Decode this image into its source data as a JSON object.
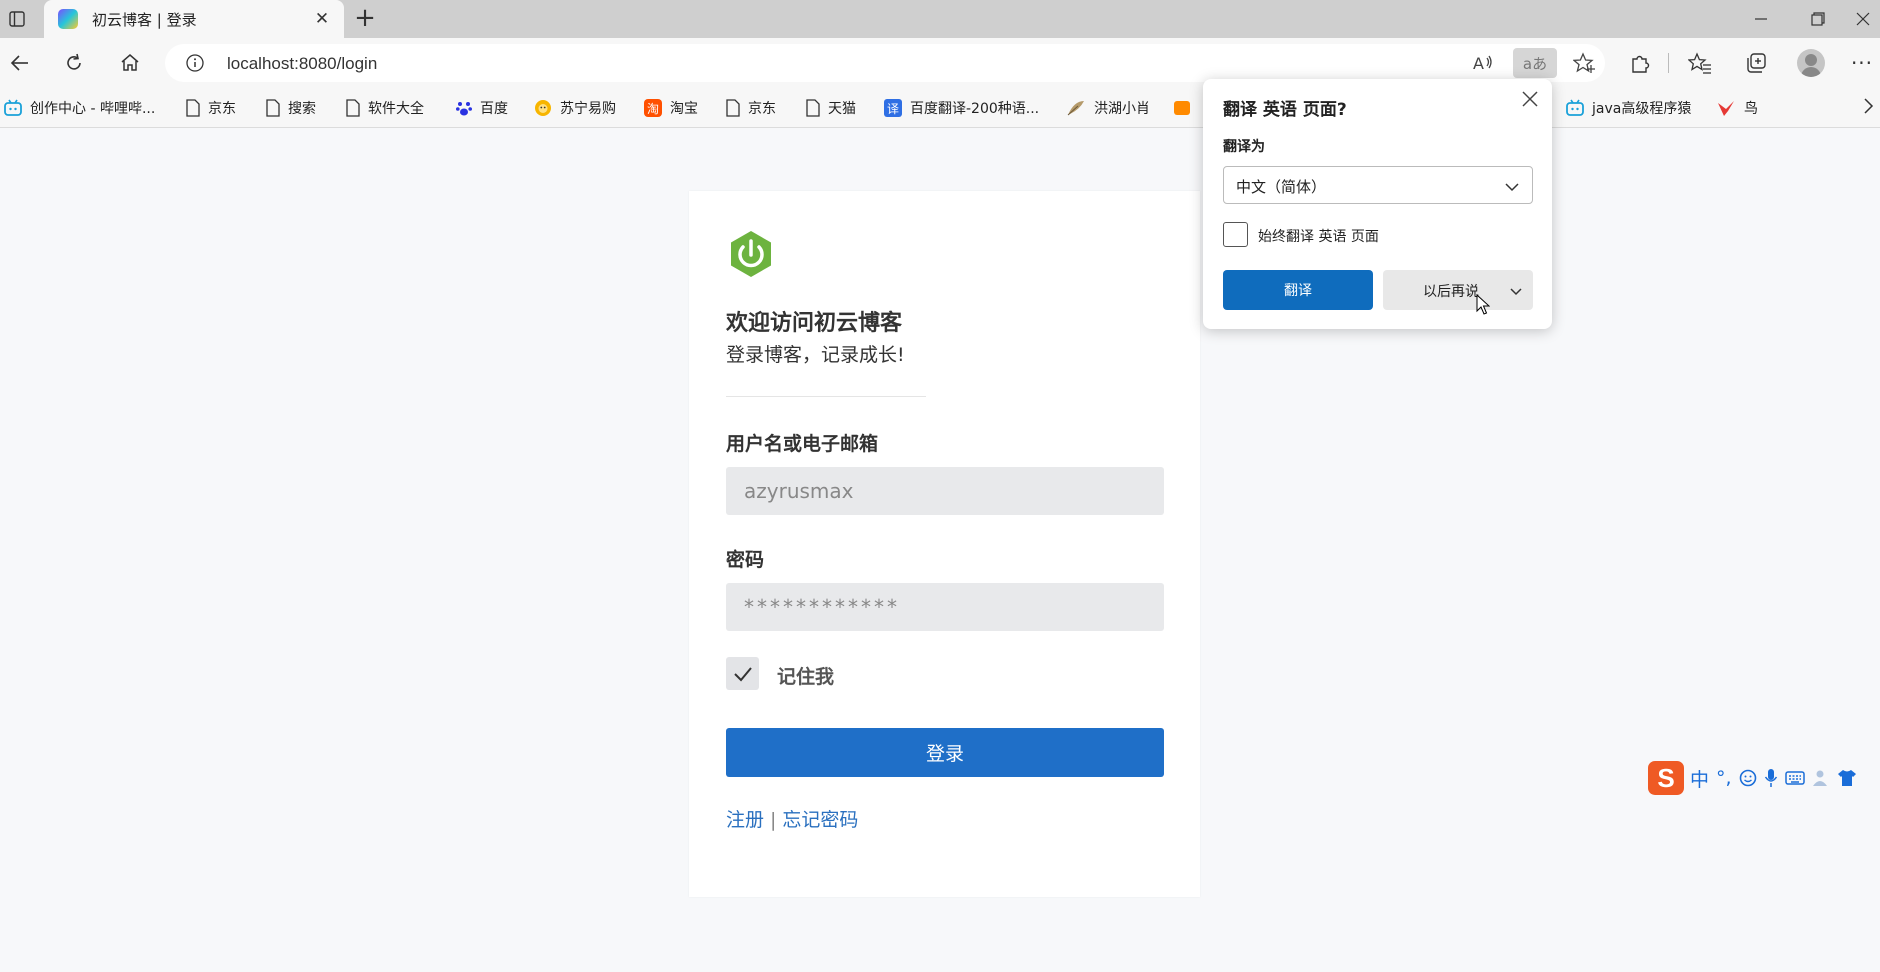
{
  "browser": {
    "tab": {
      "title": "初云博客 | 登录"
    },
    "url": "localhost:8080/login",
    "bookmarks": [
      {
        "label": "创作中心 - 哔哩哔...",
        "icon": "bilibili-icon"
      },
      {
        "label": "京东",
        "icon": "page-icon"
      },
      {
        "label": "搜索",
        "icon": "page-icon"
      },
      {
        "label": "软件大全",
        "icon": "page-icon"
      },
      {
        "label": "百度",
        "icon": "baidu-paw-icon"
      },
      {
        "label": "苏宁易购",
        "icon": "suning-lion-icon"
      },
      {
        "label": "淘宝",
        "icon": "taobao-icon"
      },
      {
        "label": "京东",
        "icon": "page-icon"
      },
      {
        "label": "天猫",
        "icon": "page-icon"
      },
      {
        "label": "百度翻译-200种语...",
        "icon": "baidu-translate-icon"
      },
      {
        "label": "洪湖小肖",
        "icon": "bird-feather-icon"
      },
      {
        "label": "java高级程序猿",
        "icon": "bilibili-icon"
      },
      {
        "label": "鸟",
        "icon": "bird-icon"
      }
    ]
  },
  "login": {
    "welcome": "欢迎访问初云博客",
    "subtitle": "登录博客，记录成长!",
    "username_label": "用户名或电子邮箱",
    "username_value": "azyrusmax",
    "password_label": "密码",
    "password_value": "************",
    "remember_label": "记住我",
    "remember_checked": true,
    "login_button": "登录",
    "register_link": "注册",
    "link_separator": "|",
    "forgot_link": "忘记密码"
  },
  "translate_popup": {
    "title": "翻译 英语 页面?",
    "translate_to_label": "翻译为",
    "target_language": "中文（简体）",
    "always_translate_label": "始终翻译 英语 页面",
    "always_translate_checked": false,
    "translate_button": "翻译",
    "later_button": "以后再说"
  },
  "ime": {
    "logo": "S",
    "mode": "中",
    "punct": "°,"
  },
  "colors": {
    "primary": "#1f6fc8",
    "link": "#2a70bf",
    "spring_green": "#6db33f",
    "edge_blue": "#0f6cbd"
  }
}
